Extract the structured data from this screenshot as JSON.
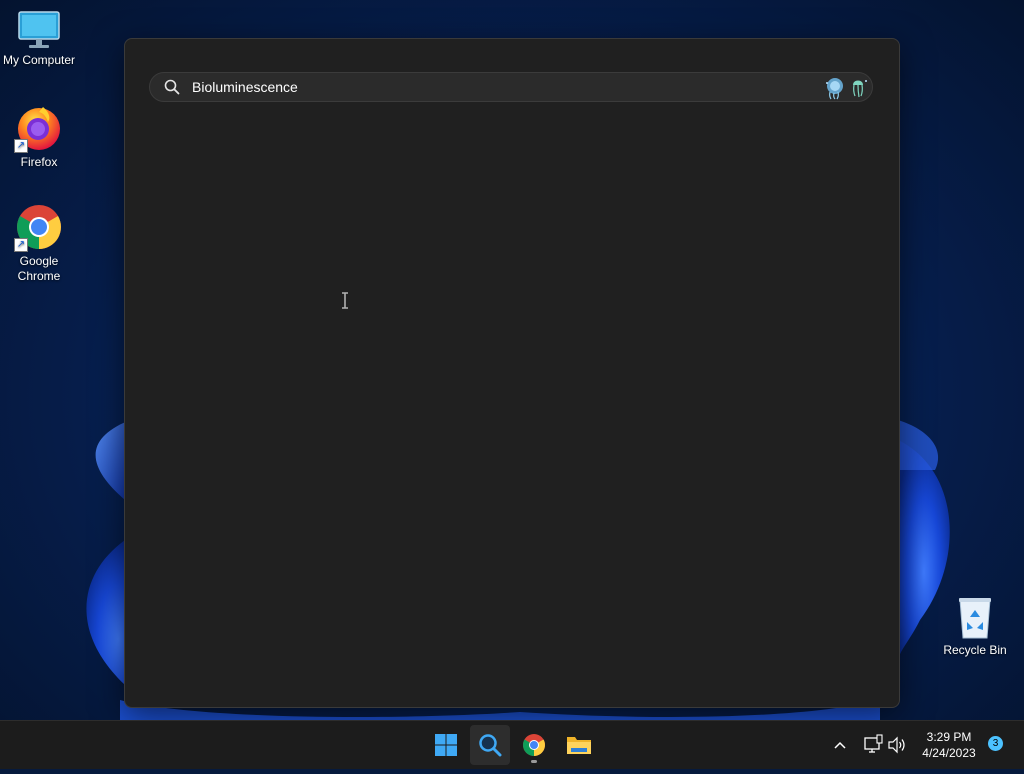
{
  "desktop": {
    "icons": [
      {
        "label": "My Computer",
        "icon": "monitor-icon"
      },
      {
        "label": "Firefox",
        "icon": "firefox-icon",
        "shortcut": true
      },
      {
        "label": "Google Chrome",
        "icon": "chrome-icon",
        "shortcut": true
      },
      {
        "label": "Recycle Bin",
        "icon": "recycle-bin-icon"
      }
    ]
  },
  "search": {
    "value": "Bioluminescence",
    "search_icon": "search-icon",
    "highlight_icon": "jellyfish-icon"
  },
  "taskbar": {
    "items": [
      {
        "name": "start",
        "icon": "windows-logo-icon"
      },
      {
        "name": "search",
        "icon": "search-icon",
        "active": true
      },
      {
        "name": "chrome",
        "icon": "chrome-icon",
        "running": true
      },
      {
        "name": "file-explorer",
        "icon": "folder-icon"
      }
    ],
    "tray": {
      "chevron_icon": "chevron-up-icon",
      "network_icon": "network-icon",
      "volume_icon": "volume-icon",
      "time": "3:29 PM",
      "date": "4/24/2023",
      "notification_count": "3"
    }
  },
  "colors": {
    "panel_bg": "#202020",
    "taskbar_bg": "#1c1c1c",
    "accent": "#4cc2ff",
    "desktop_blue": "#0d3a8c"
  }
}
